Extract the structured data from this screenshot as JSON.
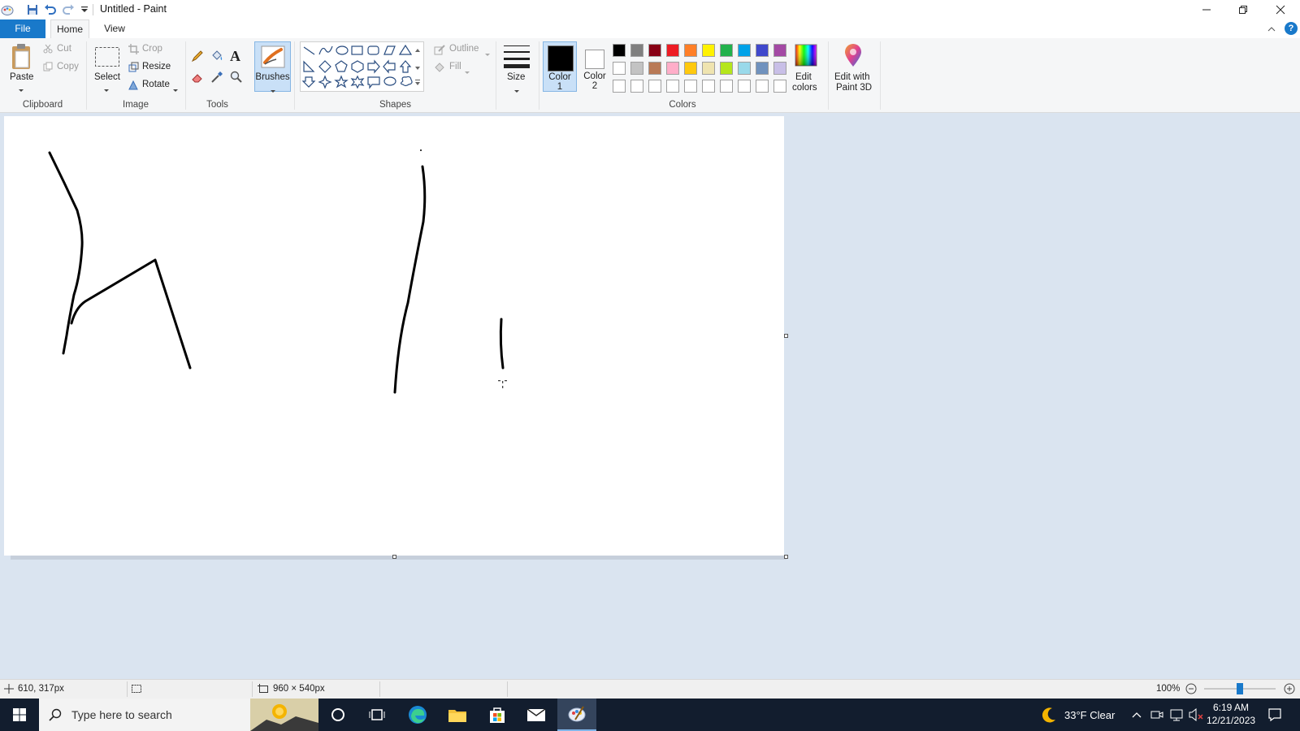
{
  "window": {
    "title": "Untitled - Paint"
  },
  "tabs": {
    "file": "File",
    "home": "Home",
    "view": "View"
  },
  "clipboard": {
    "paste": "Paste",
    "cut": "Cut",
    "copy": "Copy",
    "group": "Clipboard"
  },
  "image": {
    "select": "Select",
    "crop": "Crop",
    "resize": "Resize",
    "rotate": "Rotate",
    "group": "Image"
  },
  "tools": {
    "group": "Tools",
    "brushes": "Brushes"
  },
  "shapes": {
    "outline": "Outline",
    "fill": "Fill",
    "group": "Shapes"
  },
  "size": {
    "label": "Size"
  },
  "colors": {
    "color1": "Color",
    "color1_num": "1",
    "color2": "Color",
    "color2_num": "2",
    "edit_colors_1": "Edit",
    "edit_colors_2": "colors",
    "group": "Colors",
    "palette_row1": [
      "#000000",
      "#7f7f7f",
      "#880015",
      "#ed1c24",
      "#ff7f27",
      "#fff200",
      "#22b14c",
      "#00a2e8",
      "#3f48cc",
      "#a349a4"
    ],
    "palette_row2": [
      "#ffffff",
      "#c3c3c3",
      "#b97a57",
      "#ffaec9",
      "#ffc90e",
      "#efe4b0",
      "#b5e61d",
      "#99d9ea",
      "#7092be",
      "#c8bfe7"
    ],
    "palette_row3": [
      "#ffffff",
      "#ffffff",
      "#ffffff",
      "#ffffff",
      "#ffffff",
      "#ffffff",
      "#ffffff",
      "#ffffff",
      "#ffffff",
      "#ffffff"
    ]
  },
  "paint3d": {
    "line1": "Edit with",
    "line2": "Paint 3D"
  },
  "status": {
    "cursor_pos": "610, 317px",
    "canvas_size": "960 × 540px",
    "zoom": "100%",
    "zoom_level": 0.5
  },
  "taskbar": {
    "search_placeholder": "Type here to search",
    "weather": "33°F  Clear",
    "time": "6:19 AM",
    "date": "12/21/2023"
  }
}
